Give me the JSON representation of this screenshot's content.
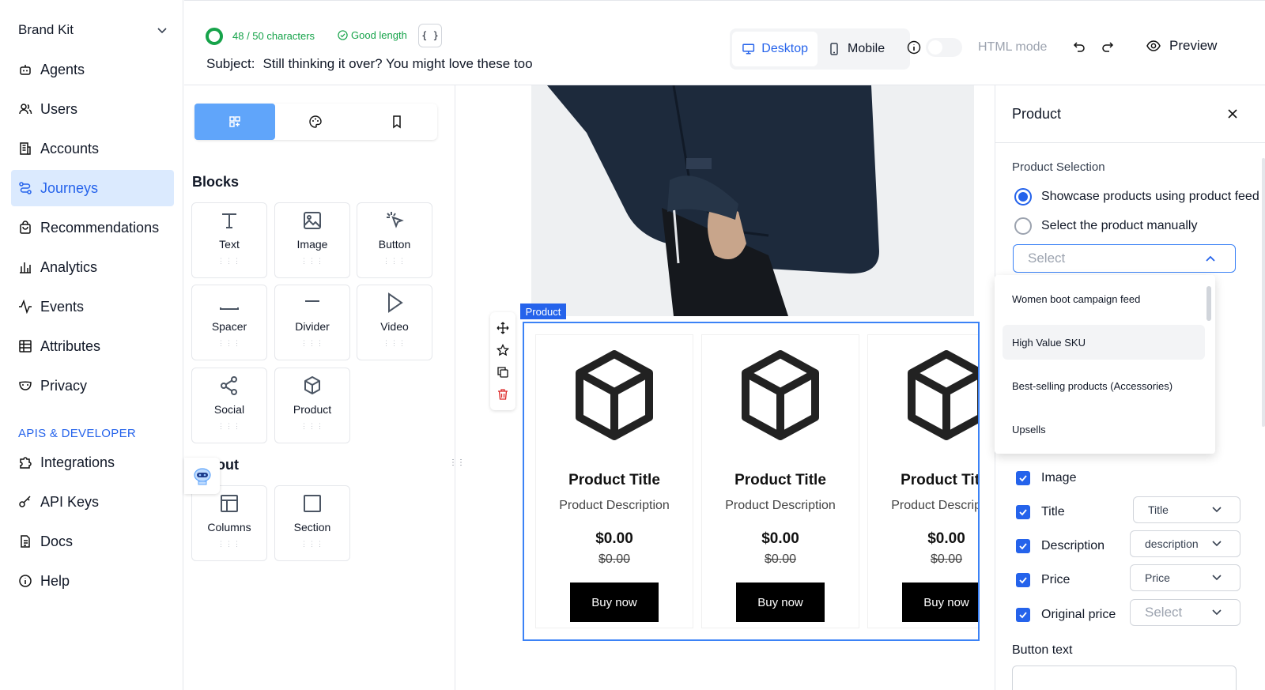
{
  "sidebar": {
    "brand": "Brand Kit",
    "items": [
      {
        "label": "Agents",
        "icon": "bot-icon"
      },
      {
        "label": "Users",
        "icon": "users-icon"
      },
      {
        "label": "Accounts",
        "icon": "building-icon"
      },
      {
        "label": "Journeys",
        "icon": "route-icon",
        "active": true
      },
      {
        "label": "Recommendations",
        "icon": "bag-icon"
      },
      {
        "label": "Analytics",
        "icon": "bar-chart-icon"
      },
      {
        "label": "Events",
        "icon": "activity-icon"
      },
      {
        "label": "Attributes",
        "icon": "table-icon"
      },
      {
        "label": "Privacy",
        "icon": "mask-icon"
      }
    ],
    "section": "APIS & DEVELOPER",
    "dev_items": [
      {
        "label": "Integrations",
        "icon": "puzzle-icon"
      },
      {
        "label": "API Keys",
        "icon": "key-icon"
      },
      {
        "label": "Docs",
        "icon": "doc-icon"
      },
      {
        "label": "Help",
        "icon": "info-icon"
      }
    ]
  },
  "topbar": {
    "char_count": "48 / 50 characters",
    "good_length": "Good length",
    "braces": "{ }",
    "subject_label": "Subject:",
    "subject_value": "Still thinking it over? You might love these too",
    "desktop": "Desktop",
    "mobile": "Mobile",
    "html_mode": "HTML mode",
    "preview": "Preview",
    "accent": "#2563eb",
    "ok_color": "#16a34a"
  },
  "blocks_panel": {
    "blocks_heading": "Blocks",
    "blocks": [
      "Text",
      "Image",
      "Button",
      "Spacer",
      "Divider",
      "Video",
      "Social",
      "Product"
    ],
    "layout_heading": "Layout",
    "layout": [
      "Columns",
      "Section"
    ]
  },
  "canvas": {
    "product_tag": "Product",
    "cards": [
      {
        "title": "Product Title",
        "desc": "Product Description",
        "price": "$0.00",
        "orig": "$0.00",
        "button": "Buy now"
      },
      {
        "title": "Product Title",
        "desc": "Product Description",
        "price": "$0.00",
        "orig": "$0.00",
        "button": "Buy now"
      },
      {
        "title": "Product Title",
        "desc": "Product Description",
        "price": "$0.00",
        "orig": "$0.00",
        "button": "Buy now"
      }
    ]
  },
  "right_panel": {
    "title": "Product",
    "selection_label": "Product Selection",
    "radio_feed": "Showcase products using product feed",
    "radio_manual": "Select the product manually",
    "select_placeholder": "Select",
    "dropdown": [
      "Women boot campaign feed",
      "High Value SKU",
      "Best-selling products (Accessories)",
      "Upsells"
    ],
    "fields": [
      {
        "label": "Image",
        "select": null
      },
      {
        "label": "Title",
        "select": "Title"
      },
      {
        "label": "Description",
        "select": "description"
      },
      {
        "label": "Price",
        "select": "Price"
      },
      {
        "label": "Original price",
        "select": "Select"
      }
    ],
    "button_text_label": "Button text"
  }
}
